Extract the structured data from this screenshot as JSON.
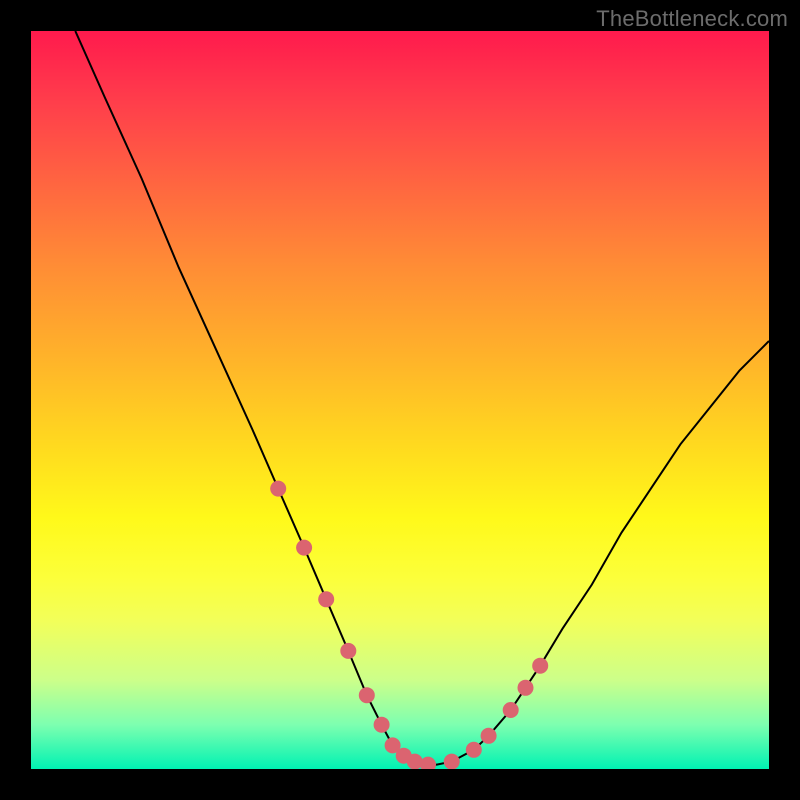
{
  "watermark": "TheBottleneck.com",
  "colors": {
    "frame": "#000000",
    "curve": "#000000",
    "marker": "#db6470",
    "gradient_top": "#ff1a4d",
    "gradient_bottom": "#00f2b2"
  },
  "chart_data": {
    "type": "line",
    "title": "",
    "xlabel": "",
    "ylabel": "",
    "xlim": [
      0,
      100
    ],
    "ylim": [
      0,
      100
    ],
    "grid": false,
    "legend": false,
    "series": [
      {
        "name": "curve",
        "x": [
          6,
          10,
          15,
          20,
          25,
          30,
          33.5,
          37,
          40,
          43,
          45.5,
          47.5,
          49,
          50.5,
          52,
          53.8,
          55,
          57,
          60,
          62,
          65,
          67,
          69,
          72,
          76,
          80,
          84,
          88,
          92,
          96,
          100
        ],
        "y": [
          100,
          91,
          80,
          68,
          57,
          46,
          38,
          30,
          23,
          16,
          10,
          6,
          3.2,
          1.8,
          1.0,
          0.6,
          0.6,
          1.0,
          2.6,
          4.5,
          8,
          11,
          14,
          19,
          25,
          32,
          38,
          44,
          49,
          54,
          58
        ]
      }
    ],
    "markers": {
      "name": "highlighted-points",
      "x": [
        33.5,
        37,
        40,
        43,
        45.5,
        47.5,
        49,
        50.5,
        52,
        53.8,
        57,
        60,
        62,
        65,
        67,
        69
      ],
      "y": [
        38,
        30,
        23,
        16,
        10,
        6,
        3.2,
        1.8,
        1.0,
        0.6,
        1.0,
        2.6,
        4.5,
        8,
        11,
        14
      ]
    }
  }
}
